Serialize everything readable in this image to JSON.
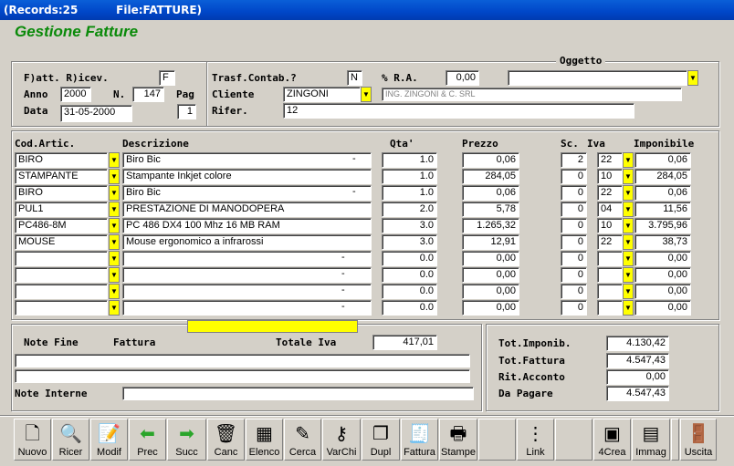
{
  "window": {
    "title": "(Records:25          File:FATTURE)"
  },
  "app_title": "Gestione Fatture",
  "header": {
    "fatt_label": "F)att. R)icev.",
    "fatt_value": "F",
    "anno_label": "Anno",
    "anno_value": "2000",
    "n_label": "N.",
    "n_value": "147",
    "pag_label": "Pag",
    "pag_value": "1",
    "data_label": "Data",
    "data_value": "31-05-2000",
    "trasf_label": "Trasf.Contab.?",
    "trasf_value": "N",
    "ra_label": "% R.A.",
    "ra_value": "0,00",
    "oggetto_label": "Oggetto",
    "oggetto_value": "",
    "cliente_label": "Cliente",
    "cliente_value": "ZINGONI",
    "cliente_desc": "ING. ZINGONI & C. SRL",
    "rifer_label": "Rifer.",
    "rifer_value": "12"
  },
  "lines": {
    "headers": {
      "cod": "Cod.Artic.",
      "desc": "Descrizione",
      "qta": "Qta'",
      "prezzo": "Prezzo",
      "sc": "Sc.",
      "iva": "Iva",
      "imponibile": "Imponibile"
    },
    "rows": [
      {
        "cod": "BIRO",
        "desc": "Biro Bic",
        "dot": "-",
        "qta": "1.0",
        "prezzo": "0,06",
        "sc": "2",
        "iva": "22",
        "imp": "0,06"
      },
      {
        "cod": "STAMPANTE",
        "desc": "Stampante Inkjet colore",
        "dot": "",
        "qta": "1.0",
        "prezzo": "284,05",
        "sc": "0",
        "iva": "10",
        "imp": "284,05"
      },
      {
        "cod": "BIRO",
        "desc": "Biro Bic",
        "dot": "-",
        "qta": "1.0",
        "prezzo": "0,06",
        "sc": "0",
        "iva": "22",
        "imp": "0,06"
      },
      {
        "cod": "PUL1",
        "desc": "PRESTAZIONE DI MANODOPERA",
        "dot": "",
        "qta": "2.0",
        "prezzo": "5,78",
        "sc": "0",
        "iva": "04",
        "imp": "11,56"
      },
      {
        "cod": "PC486-8M",
        "desc": "PC 486 DX4 100 Mhz 16 MB RAM",
        "dot": "",
        "qta": "3.0",
        "prezzo": "1.265,32",
        "sc": "0",
        "iva": "10",
        "imp": "3.795,96"
      },
      {
        "cod": "MOUSE",
        "desc": "Mouse ergonomico a infrarossi",
        "dot": "",
        "qta": "3.0",
        "prezzo": "12,91",
        "sc": "0",
        "iva": "22",
        "imp": "38,73"
      },
      {
        "cod": "",
        "desc": "",
        "dot": "-",
        "qta": "0.0",
        "prezzo": "0,00",
        "sc": "0",
        "iva": "",
        "imp": "0,00"
      },
      {
        "cod": "",
        "desc": "",
        "dot": "-",
        "qta": "0.0",
        "prezzo": "0,00",
        "sc": "0",
        "iva": "",
        "imp": "0,00"
      },
      {
        "cod": "",
        "desc": "",
        "dot": "-",
        "qta": "0.0",
        "prezzo": "0,00",
        "sc": "0",
        "iva": "",
        "imp": "0,00"
      },
      {
        "cod": "",
        "desc": "",
        "dot": "-",
        "qta": "0.0",
        "prezzo": "0,00",
        "sc": "0",
        "iva": "",
        "imp": "0,00"
      }
    ]
  },
  "footer": {
    "note_fine_label": "Note Fine",
    "fattura_label": "Fattura",
    "totale_iva_label": "Totale Iva",
    "totale_iva_value": "417,01",
    "note_interne_label": "Note Interne",
    "tot_imponib_label": "Tot.Imponib.",
    "tot_imponib_value": "4.130,42",
    "tot_fattura_label": "Tot.Fattura",
    "tot_fattura_value": "4.547,43",
    "rit_acconto_label": "Rit.Acconto",
    "rit_acconto_value": "0,00",
    "da_pagare_label": "Da Pagare",
    "da_pagare_value": "4.547,43"
  },
  "toolbar": [
    {
      "name": "nuovo",
      "label": "Nuovo",
      "icon": "new-document-icon",
      "glyph": "🗋"
    },
    {
      "name": "ricer",
      "label": "Ricer",
      "icon": "magnifier-icon",
      "glyph": "🔍"
    },
    {
      "name": "modif",
      "label": "Modif",
      "icon": "edit-document-icon",
      "glyph": "📝"
    },
    {
      "name": "prec",
      "label": "Prec",
      "icon": "arrow-left-icon",
      "glyph": "⬅"
    },
    {
      "name": "succ",
      "label": "Succ",
      "icon": "arrow-right-icon",
      "glyph": "➡"
    },
    {
      "name": "canc",
      "label": "Canc",
      "icon": "trash-icon",
      "glyph": "🗑"
    },
    {
      "name": "elenco",
      "label": "Elenco",
      "icon": "list-icon",
      "glyph": "▦"
    },
    {
      "name": "cerca",
      "label": "Cerca",
      "icon": "search-filter-icon",
      "glyph": "✎"
    },
    {
      "name": "varchi",
      "label": "VarChi",
      "icon": "keys-icon",
      "glyph": "⚷"
    },
    {
      "name": "dupl",
      "label": "Dupl",
      "icon": "duplicate-icon",
      "glyph": "❐"
    },
    {
      "name": "fattura",
      "label": "Fattura",
      "icon": "invoice-icon",
      "glyph": "🧾"
    },
    {
      "name": "stampe",
      "label": "Stampe",
      "icon": "printer-icon",
      "glyph": "🖶"
    },
    {
      "name": "empty1",
      "label": "",
      "icon": "",
      "glyph": ""
    },
    {
      "name": "link",
      "label": "Link",
      "icon": "link-tree-icon",
      "glyph": "⋮"
    },
    {
      "name": "empty2",
      "label": "",
      "icon": "",
      "glyph": ""
    },
    {
      "name": "4crea",
      "label": "4Crea",
      "icon": "create-icon",
      "glyph": "▣"
    },
    {
      "name": "immag",
      "label": "Immag",
      "icon": "image-card-icon",
      "glyph": "▤"
    },
    {
      "name": "empty3",
      "label": "",
      "icon": "",
      "glyph": ""
    },
    {
      "name": "uscita",
      "label": "Uscita",
      "icon": "exit-door-icon",
      "glyph": "🚪"
    }
  ],
  "colors": {
    "title_green": "#0a8a0a",
    "titlebar_blue": "#0046c8",
    "accent_yellow": "#ffff00"
  }
}
